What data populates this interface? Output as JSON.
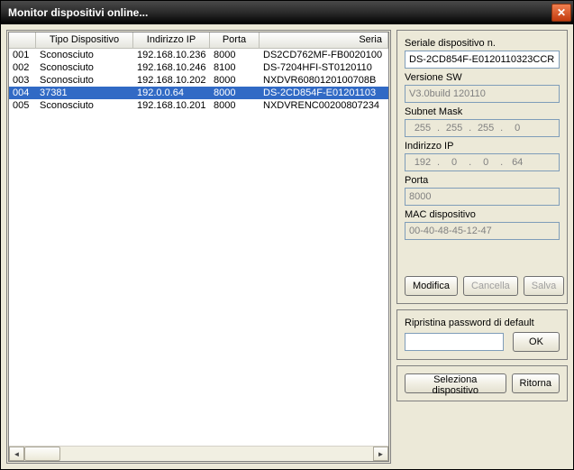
{
  "window": {
    "title": "Monitor dispositivi online..."
  },
  "table": {
    "headers": {
      "type": "Tipo Dispositivo",
      "ip": "Indirizzo IP",
      "port": "Porta",
      "serial": "Seria"
    },
    "rows": [
      {
        "idx": "001",
        "type": "Sconosciuto",
        "ip": "192.168.10.236",
        "port": "8000",
        "serial": "DS2CD762MF-FB0020100",
        "selected": false
      },
      {
        "idx": "002",
        "type": "Sconosciuto",
        "ip": "192.168.10.246",
        "port": "8100",
        "serial": "DS-7204HFI-ST0120110",
        "selected": false
      },
      {
        "idx": "003",
        "type": "Sconosciuto",
        "ip": "192.168.10.202",
        "port": "8000",
        "serial": "NXDVR6080120100708B",
        "selected": false
      },
      {
        "idx": "004",
        "type": "37381",
        "ip": "192.0.0.64",
        "port": "8000",
        "serial": "DS-2CD854F-E01201103",
        "selected": true
      },
      {
        "idx": "005",
        "type": "Sconosciuto",
        "ip": "192.168.10.201",
        "port": "8000",
        "serial": "NXDVRENC00200807234",
        "selected": false
      }
    ]
  },
  "details": {
    "serial_label": "Seriale dispositivo n.",
    "serial_value": "DS-2CD854F-E0120110323CCR",
    "version_label": "Versione SW",
    "version_value": "V3.0build 120110",
    "subnet_label": "Subnet Mask",
    "subnet": {
      "a": "255",
      "b": "255",
      "c": "255",
      "d": "0"
    },
    "ip_label": "Indirizzo IP",
    "ip": {
      "a": "192",
      "b": "0",
      "c": "0",
      "d": "64"
    },
    "port_label": "Porta",
    "port_value": "8000",
    "mac_label": "MAC dispositivo",
    "mac_value": "00-40-48-45-12-47"
  },
  "buttons": {
    "modify": "Modifica",
    "delete": "Cancella",
    "save": "Salva",
    "restore_label": "Ripristina password di default",
    "ok": "OK",
    "select_device": "Seleziona dispositivo",
    "return": "Ritorna"
  }
}
